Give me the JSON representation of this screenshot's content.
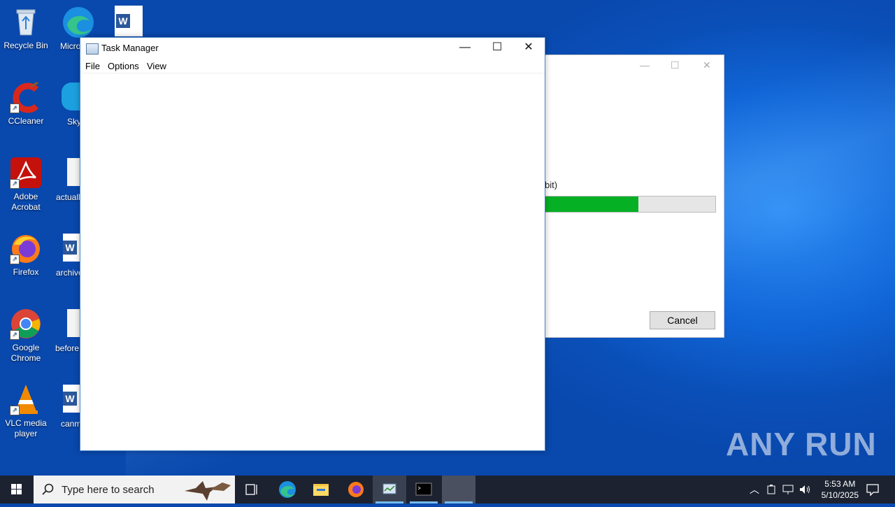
{
  "desktop": {
    "icons": [
      {
        "label": "Recycle Bin"
      },
      {
        "label": "CCleaner"
      },
      {
        "label": "Adobe Acrobat"
      },
      {
        "label": "Firefox"
      },
      {
        "label": "Google Chrome"
      },
      {
        "label": "VLC media player"
      }
    ],
    "icons_col2": [
      {
        "label": "Micro Edg"
      },
      {
        "label": "Sky"
      },
      {
        "label": "actuall"
      },
      {
        "label": "archive"
      },
      {
        "label": "before"
      },
      {
        "label": "canm"
      }
    ]
  },
  "installer": {
    "partial_text": "bit)",
    "progress_fraction": 0.55,
    "cancel_label": "Cancel",
    "progress_color": "#06b025"
  },
  "task_manager": {
    "title": "Task Manager",
    "menu": [
      "File",
      "Options",
      "View"
    ]
  },
  "taskbar": {
    "search_placeholder": "Type here to search",
    "time": "5:53 AM",
    "date": "5/10/2025",
    "accent": "#76b9ed"
  },
  "watermark": "ANY RUN"
}
